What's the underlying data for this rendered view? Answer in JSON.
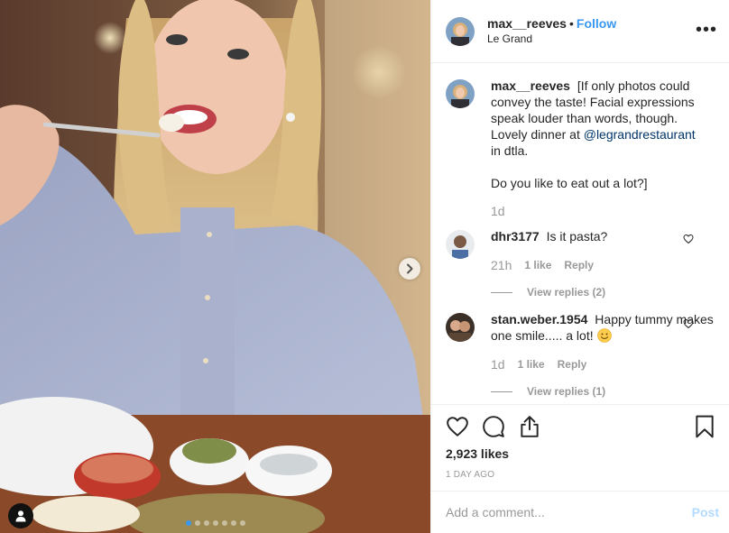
{
  "post": {
    "author": "max__reeves",
    "separator": "•",
    "follow_label": "Follow",
    "location": "Le Grand",
    "more_icon": "more-options-icon",
    "carousel_slides": 7,
    "carousel_active_index": 0
  },
  "caption": {
    "username": "max__reeves",
    "text_before": "[If only photos could convey the taste! Facial expressions speak louder than words, though. Lovely dinner at ",
    "mention": "@legrandrestaurant",
    "text_after": "\nin dtla.\n\nDo you like to eat out a lot?]",
    "age": "1d"
  },
  "comments": [
    {
      "username": "dhr3177",
      "text": "Is it pasta?",
      "age": "21h",
      "likes": "1 like",
      "reply_label": "Reply",
      "view_replies": "View replies (2)"
    },
    {
      "username": "stan.weber.1954",
      "text": "Happy tummy makes one smile..... a lot!",
      "age": "1d",
      "likes": "1 like",
      "reply_label": "Reply",
      "view_replies": "View replies (1)"
    }
  ],
  "actions": {
    "likes": "2,923 likes",
    "post_age": "1 DAY AGO"
  },
  "add_comment": {
    "placeholder": "Add a comment...",
    "post_label": "Post"
  },
  "colors": {
    "link_blue": "#3897f0",
    "mention_blue": "#003569",
    "muted": "#999999",
    "post_disabled": "#b3dbff"
  }
}
